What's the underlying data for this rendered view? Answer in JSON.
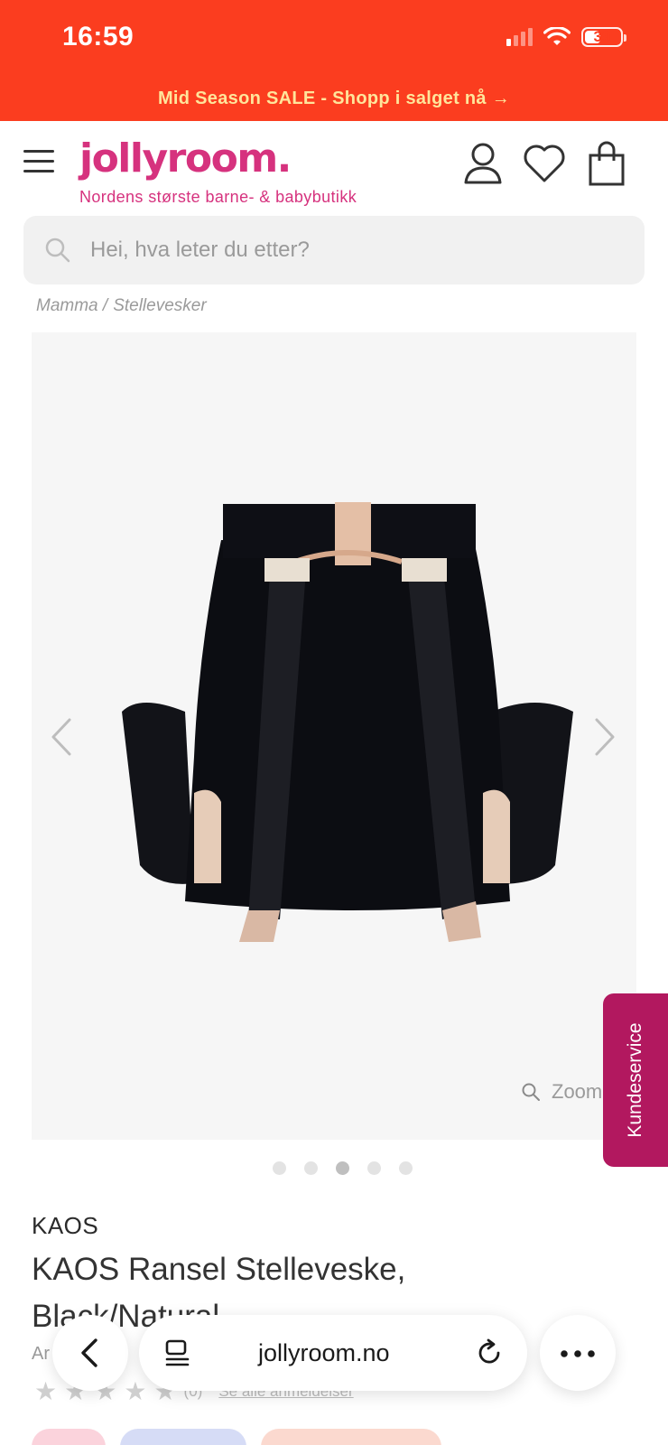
{
  "status_bar": {
    "time": "16:59",
    "battery": "39",
    "icons": [
      "signal-icon",
      "wifi-icon",
      "battery-icon"
    ]
  },
  "promo": {
    "text": "Mid Season SALE - Shopp i salget nå →"
  },
  "header": {
    "logo": "jollyroom.",
    "tagline": "Nordens største barne- & babybutikk",
    "icons": [
      "menu-icon",
      "user-icon",
      "heart-icon",
      "bag-icon"
    ]
  },
  "search": {
    "placeholder": "Hei, hva leter du etter?"
  },
  "breadcrumb": {
    "items": [
      "Mamma /",
      "Stellevesker"
    ]
  },
  "gallery": {
    "zoom_label": "Zoom",
    "slide_count": 5,
    "active_slide": 3
  },
  "customer_service": {
    "label": "Kundeservice"
  },
  "product": {
    "brand": "KAOS",
    "title": "KAOS Ransel Stelleveske, Black/Natural",
    "artnr_partial": "Ar   2523",
    "rating_count": "(0)",
    "rating_link": "Se alle anmeldelser"
  },
  "browser": {
    "url": "jollyroom.no"
  },
  "colors": {
    "promo_bg": "#fb3d1f",
    "promo_text": "#ffe59b",
    "brand_pink": "#d6327e",
    "customer_service_bg": "#b2185f"
  }
}
